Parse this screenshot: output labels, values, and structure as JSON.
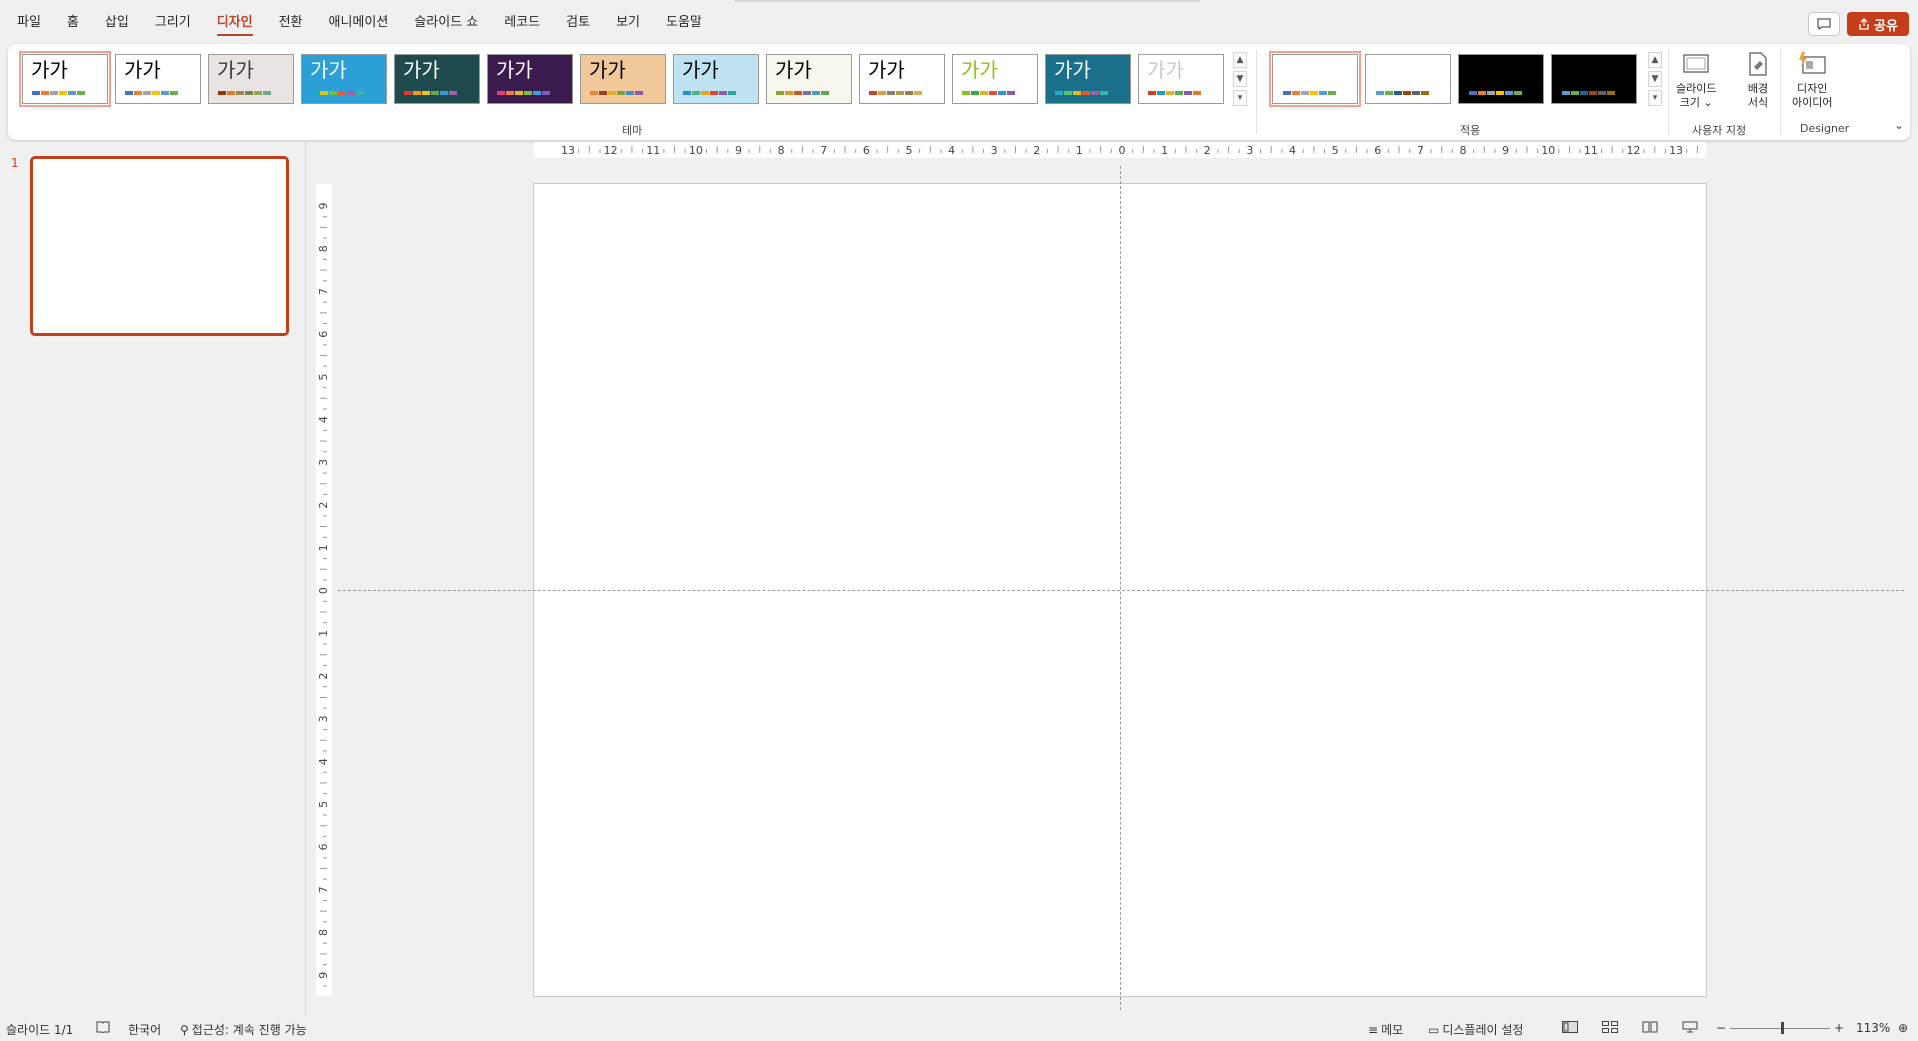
{
  "menu": {
    "tabs": [
      "파일",
      "홈",
      "삽입",
      "그리기",
      "디자인",
      "전환",
      "애니메이션",
      "슬라이드 쇼",
      "레코드",
      "검토",
      "보기",
      "도움말"
    ],
    "active_tab": "디자인",
    "share_label": "공유"
  },
  "ribbon": {
    "themes_group_label": "테마",
    "variants_group_label": "적용",
    "customize_group_label": "사용자 지정",
    "designer_group_label": "Designer",
    "theme_label": "가가",
    "themes": [
      {
        "bg": "#ffffff",
        "text": "#000000",
        "dots": [
          "#4472c4",
          "#ed7d31",
          "#a5a5a5",
          "#ffc000",
          "#5b9bd5",
          "#70ad47"
        ]
      },
      {
        "bg": "#ffffff",
        "text": "#000000",
        "dots": [
          "#4472c4",
          "#ed7d31",
          "#a5a5a5",
          "#ffc000",
          "#5b9bd5",
          "#70ad47"
        ]
      },
      {
        "bg": "#e9e4e2",
        "text": "#3b3b3b",
        "dots": [
          "#a53010",
          "#de7e18",
          "#9f8351",
          "#728653",
          "#92aa4c",
          "#6aac91"
        ]
      },
      {
        "bg": "#2aa0d6",
        "text": "#ffffff",
        "dots": [
          "#16a8d2",
          "#e4c20a",
          "#6ac248",
          "#df5c3d",
          "#a45ea8",
          "#36b6a9"
        ]
      },
      {
        "bg": "#1f4b4f",
        "text": "#ffffff",
        "dots": [
          "#e33a27",
          "#f29b1d",
          "#e0c71a",
          "#6aa84f",
          "#2f9fd8",
          "#a45ea8"
        ]
      },
      {
        "bg": "#3b1a4d",
        "text": "#ffffff",
        "dots": [
          "#e03f7e",
          "#ef7f2b",
          "#e7b81e",
          "#7cbf3e",
          "#35a6d9",
          "#8b55c7"
        ]
      },
      {
        "bg": "#f0c89a",
        "text": "#000000",
        "dots": [
          "#e3883a",
          "#a23b25",
          "#d9b21f",
          "#7d9f3c",
          "#4b8dc9",
          "#8a5aab"
        ]
      },
      {
        "bg": "#bfe3f2",
        "text": "#000000",
        "dots": [
          "#2a8dd4",
          "#52b58c",
          "#e2a51f",
          "#d8492c",
          "#8a5aab",
          "#29a3a3"
        ]
      },
      {
        "bg": "#f6f6ea",
        "text": "#000000",
        "dots": [
          "#93a138",
          "#d89b2b",
          "#c65b2a",
          "#7f6e9f",
          "#4f9bc0",
          "#6ba34a"
        ]
      },
      {
        "bg": "#ffffff",
        "text": "#000000",
        "dots": [
          "#c6452a",
          "#e39a3a",
          "#8a7d6a",
          "#b39b52",
          "#9c7a56",
          "#d4b15a"
        ]
      },
      {
        "bg": "#ffffff",
        "text": "#8fbf21",
        "dots": [
          "#8fbf21",
          "#2fa855",
          "#e1b41f",
          "#e2552b",
          "#2a94d6",
          "#8a5aab"
        ]
      },
      {
        "bg": "#1a6f8a",
        "text": "#ffffff",
        "dots": [
          "#28a9c9",
          "#56c26a",
          "#e0c21d",
          "#df5d2e",
          "#a45ea8",
          "#37b7a8"
        ]
      },
      {
        "bg": "#ffffff",
        "text": "#c9c9c9",
        "dots": [
          "#d83b2b",
          "#2a94d6",
          "#e1b41f",
          "#54b04a",
          "#8a5aab",
          "#e37b2b"
        ]
      }
    ],
    "variants": [
      {
        "bg": "#ffffff",
        "dots": [
          "#4472c4",
          "#ed7d31",
          "#a5a5a5",
          "#ffc000",
          "#5b9bd5",
          "#70ad47"
        ]
      },
      {
        "bg": "#ffffff",
        "dots": [
          "#5b9bd5",
          "#70ad47",
          "#255e91",
          "#9e480e",
          "#636363",
          "#997300"
        ]
      },
      {
        "bg": "#000000",
        "dots": [
          "#4472c4",
          "#ed7d31",
          "#a5a5a5",
          "#ffc000",
          "#5b9bd5",
          "#70ad47"
        ]
      },
      {
        "bg": "#000000",
        "dots": [
          "#5b9bd5",
          "#70ad47",
          "#255e91",
          "#9e480e",
          "#636363",
          "#997300"
        ]
      }
    ],
    "slide_size_line1": "슬라이드",
    "slide_size_line2": "크기",
    "format_bg_line1": "배경",
    "format_bg_line2": "서식",
    "design_ideas_line1": "디자인",
    "design_ideas_line2": "아이디어"
  },
  "thumbnails": {
    "number": "1"
  },
  "rulers": {
    "h_labels": [
      "13",
      "12",
      "11",
      "10",
      "9",
      "8",
      "7",
      "6",
      "5",
      "4",
      "3",
      "2",
      "1",
      "0",
      "1",
      "2",
      "3",
      "4",
      "5",
      "6",
      "7",
      "8",
      "9",
      "10",
      "11",
      "12",
      "13"
    ],
    "v_labels": [
      "9",
      "8",
      "7",
      "6",
      "5",
      "4",
      "3",
      "2",
      "1",
      "0",
      "1",
      "2",
      "3",
      "4",
      "5",
      "6",
      "7",
      "8",
      "9"
    ]
  },
  "status": {
    "slide_count": "슬라이드 1/1",
    "language": "한국어",
    "accessibility": "접근성: 계속 진행 가능",
    "notes": "메모",
    "display_settings": "디스플레이 설정",
    "zoom": "113%"
  },
  "colors": {
    "accent": "#c43e1c",
    "ribbon_bg": "#ffffff",
    "app_bg": "#f0f0f0"
  }
}
